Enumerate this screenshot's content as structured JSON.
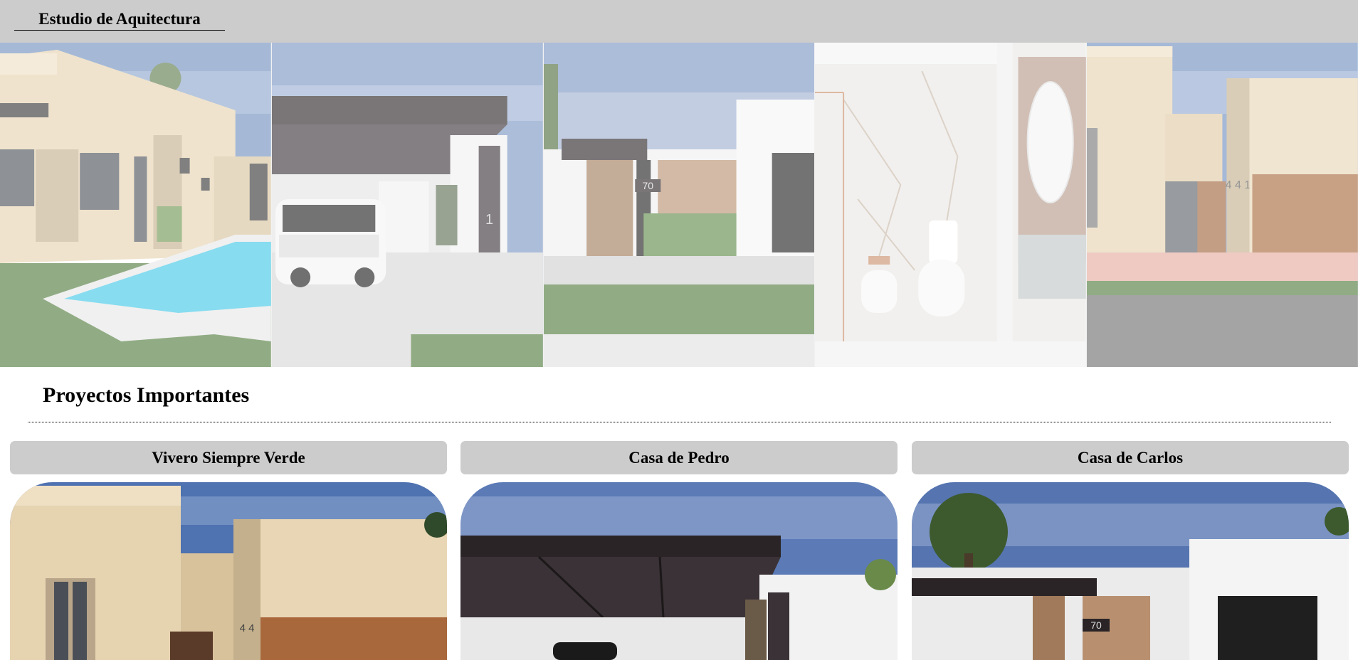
{
  "header": {
    "brand": "Estudio de Aquitectura"
  },
  "banner": {
    "panels": [
      {
        "name": "house-pool-render"
      },
      {
        "name": "carport-render"
      },
      {
        "name": "facade-70-render"
      },
      {
        "name": "bathroom-render"
      },
      {
        "name": "facade-stone-render"
      }
    ],
    "labels": {
      "panel2_number": "1",
      "panel3_number": "70",
      "panel5_number": "4 4 1"
    }
  },
  "projects": {
    "title": "Proyectos Importantes",
    "cards": [
      {
        "title": "Vivero Siempre Verde",
        "number": "4 4"
      },
      {
        "title": "Casa de Pedro"
      },
      {
        "title": "Casa de Carlos",
        "number": "70"
      }
    ]
  },
  "colors": {
    "header_bg": "#cccccc",
    "card_title_bg": "#cccccc",
    "sky": "#6f8fc0",
    "beige_wall": "#e6d3b0",
    "wood": "#a0643c",
    "stone": "#c4b08c",
    "roof_dark": "#2a2426",
    "grass": "#4f7a3a",
    "pool": "#3fc7e8"
  }
}
